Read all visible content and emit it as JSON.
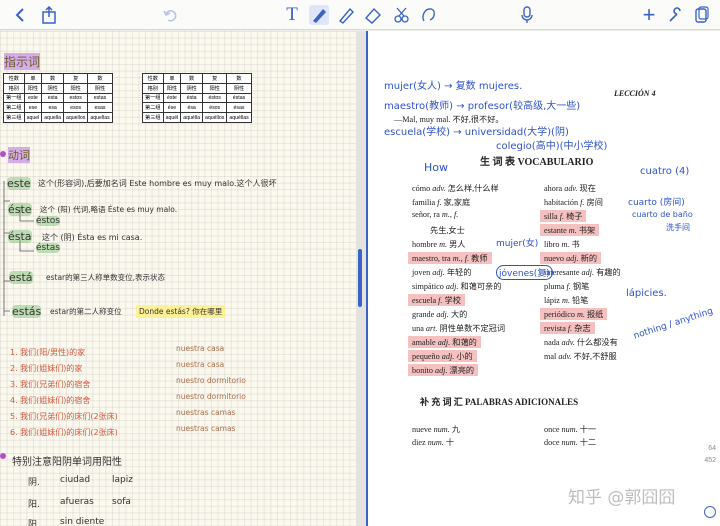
{
  "toolbar": {
    "icons": [
      "back-chevron-icon",
      "share-icon",
      "undo-icon",
      "text-tool-icon",
      "pen-icon",
      "highlighter-icon",
      "eraser-icon",
      "lasso-icon",
      "shape-icon",
      "mic-icon",
      "add-page-icon",
      "settings-icon",
      "pages-icon"
    ]
  },
  "left": {
    "heading_demo": "指示词",
    "table1_header": [
      "性数",
      "单",
      "数",
      "复",
      "数"
    ],
    "table1_sub": [
      "格别",
      "阳性",
      "阴性",
      "阳性",
      "阴性"
    ],
    "table1_rows": [
      [
        "第一组",
        "este",
        "esta",
        "estos",
        "estas"
      ],
      [
        "第二组",
        "ese",
        "esa",
        "esos",
        "esas"
      ],
      [
        "第三组",
        "aquel",
        "aquella",
        "aquellos",
        "aquellas"
      ]
    ],
    "table2_header": [
      "性数",
      "单",
      "数",
      "复",
      "数"
    ],
    "table2_sub": [
      "格别",
      "阳性",
      "阴性",
      "阳性",
      "阴性"
    ],
    "table2_rows": [
      [
        "第一组",
        "éste",
        "ésta",
        "éstos",
        "éstas"
      ],
      [
        "第二组",
        "ése",
        "ésa",
        "ésos",
        "ésas"
      ],
      [
        "第三组",
        "aquél",
        "aquélla",
        "aquéllos",
        "aquéllas"
      ]
    ],
    "heading_verb": "动词",
    "line_este": "este",
    "line_este_note": "这个(形容词),后要加名词 Este hombre es muy malo.这个人很坏",
    "line_este2": "éste",
    "line_este2_note": "这个 (阳) 代词,略语 Éste es muy malo.",
    "line_estos": "éstos",
    "line_esta": "ésta",
    "line_esta_note": "这个 (阴) Ésta es mi casa.",
    "line_estas": "éstas",
    "line_esta_verb": "está",
    "line_esta_verb_note": "estar的第三人称单数变位,表示状态",
    "line_estas_verb": "estás",
    "line_estas_verb_note": "estar的第二人称变位",
    "line_donde": "Donde estás? 你在哪里",
    "list_items": [
      [
        "1. 我们(阳/男性)的家",
        "nuestra casa"
      ],
      [
        "2. 我们(姐妹们)的家",
        "nuestra casa"
      ],
      [
        "3. 我们(兄弟们)的宿舍",
        "nuestro dormitorio"
      ],
      [
        "4. 我们(姐妹们)的宿舍",
        "nuestro dormitorio"
      ],
      [
        "5. 我们(兄弟们)的床们(2张床)",
        "nuestras camas"
      ],
      [
        "6. 我们(姐妹们)的床们(2张床)",
        "nuestras camas"
      ]
    ],
    "note_gender": "特别注意阳阴单词用阳性",
    "gender_rows": [
      [
        "阴.",
        "ciudad",
        "lapiz"
      ],
      [
        "阳.",
        "afueras",
        "sofa"
      ],
      [
        "阳",
        "sin diente",
        ""
      ]
    ]
  },
  "right": {
    "hand_mujer": "mujer(女人) → 复数 mujeres.",
    "hand_maestro": "maestro(教师) → profesor(较高级,大一些)",
    "hand_escuela": "escuela(学校) → universidad(大学)(阴)",
    "hand_colegio": "colegio(高中)(中小学校)",
    "lesson": "LECCIÓN 4",
    "mal_line": "—Mal, muy mal. 不好,很不好。",
    "how": "How",
    "vocab_title": "生 词 表   VOCABULARIO",
    "vocab_left": [
      [
        "cómo",
        "adv.",
        "怎么样,什么样"
      ],
      [
        "familia",
        "f.",
        "家,家庭"
      ],
      [
        "señor, ra",
        "m., f.",
        ""
      ],
      [
        "",
        "",
        "先生,女士"
      ],
      [
        "hombre",
        "m.",
        "男人"
      ],
      [
        "maestro, tra",
        "m., f.",
        "教师"
      ],
      [
        "joven",
        "adj.",
        "年轻的"
      ],
      [
        "simpático",
        "adj.",
        "和蔼可亲的"
      ],
      [
        "escuela",
        "f.",
        "学校"
      ],
      [
        "grande",
        "adj.",
        "大的"
      ],
      [
        "una",
        "art.",
        "阴性单数不定冠词"
      ],
      [
        "amable",
        "adj.",
        "和蔼的"
      ],
      [
        "pequeño",
        "adj.",
        "小的"
      ],
      [
        "bonito",
        "adj.",
        "漂亮的"
      ]
    ],
    "vocab_right": [
      [
        "ahora",
        "adv.",
        "现在"
      ],
      [
        "habitación",
        "f.",
        "房间"
      ],
      [
        "silla",
        "f.",
        "椅子"
      ],
      [
        "estante",
        "m.",
        "书架"
      ],
      [
        "libro",
        "m.",
        "书"
      ],
      [
        "nuevo",
        "adj.",
        "新的"
      ],
      [
        "interesante",
        "adj.",
        "有趣的"
      ],
      [
        "pluma",
        "f.",
        "钢笔"
      ],
      [
        "lápiz",
        "m.",
        "铅笔"
      ],
      [
        "periódico",
        "m.",
        "报纸"
      ],
      [
        "revista",
        "f.",
        "杂志"
      ],
      [
        "nada",
        "adv.",
        "什么都没有"
      ],
      [
        "mal",
        "adv.",
        "不好,不舒服"
      ]
    ],
    "hand_mujer2": "mujer(女)",
    "hand_jovenes": "jóvenes(复)",
    "hand_cuatro": "cuatro (4)",
    "hand_cuarto": "cuarto (房间)",
    "hand_cuarto_bano": "cuarto de baño",
    "hand_xishou": "洗手间",
    "hand_lapicies": "lápicies.",
    "hand_nothing": "nothing / anything",
    "supp_title": "补 充 词 汇   PALABRAS ADICIONALES",
    "supp_left": [
      [
        "nueve",
        "num.",
        "九"
      ],
      [
        "diez",
        "num.",
        "十"
      ]
    ],
    "supp_right": [
      [
        "once",
        "num.",
        "十一"
      ],
      [
        "doce",
        "num.",
        "十二"
      ]
    ],
    "page_num_1": "64",
    "page_num_2": "452",
    "watermark": "知乎 @郭囧囧"
  }
}
